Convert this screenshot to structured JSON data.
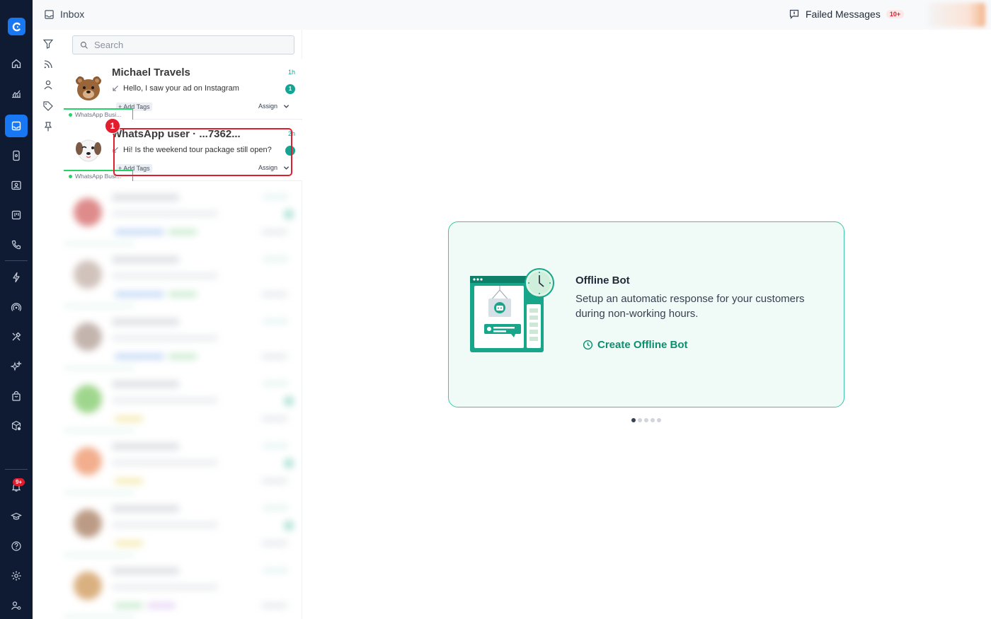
{
  "topbar": {
    "title": "Inbox",
    "failed_label": "Failed Messages",
    "failed_badge": "10+"
  },
  "nav": {
    "notifications_badge": "9+"
  },
  "search": {
    "placeholder": "Search"
  },
  "conversations": [
    {
      "name": "Michael Travels",
      "time": "1h",
      "message": "Hello, I saw your ad on Instagram",
      "unread": "1",
      "tags": "+ Add Tags",
      "assign": "Assign",
      "source": "WhatsApp Busi..."
    },
    {
      "name": "WhatsApp user · ...7362...",
      "time": "2h",
      "message": "Hi! Is the weekend tour package still open?",
      "unread": "",
      "tags": "+ Add Tags",
      "assign": "Assign",
      "source": "WhatsApp Busi..."
    }
  ],
  "step_badge": "1",
  "offline_card": {
    "title": "Offline Bot",
    "description": "Setup an automatic response for your customers during non-working hours.",
    "cta": "Create Offline Bot"
  },
  "colors": {
    "nav_bg": "#0f1b33",
    "accent": "#1877f2",
    "teal": "#15a394",
    "highlight": "#e11d2e"
  }
}
